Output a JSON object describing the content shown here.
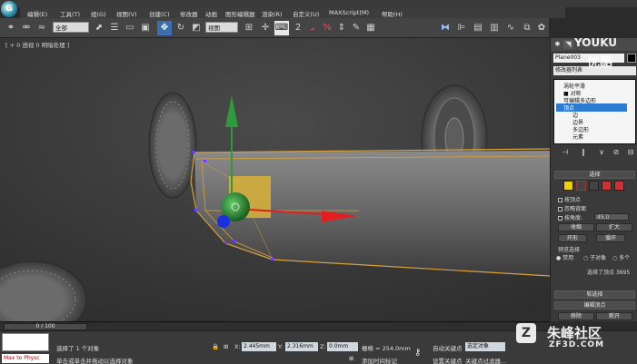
{
  "menu": [
    "编辑(E)",
    "工具(T)",
    "组(G)",
    "视图(V)",
    "创建(C)",
    "修改器",
    "动画",
    "图形编辑器",
    "渲染(R)",
    "自定义(U)",
    "MAXScript(M)",
    "帮助(H)"
  ],
  "toolbar": {
    "selection_set": "全部",
    "view_dropdown": "视图"
  },
  "viewport": {
    "label": "[ + 0 透视 0 明暗处理 ]"
  },
  "panel": {
    "object_name": "Plane003",
    "modifier_list": "修改器列表",
    "stack": [
      "涡轮平滑",
      "■ 对称",
      "可编辑多边形",
      "顶点",
      "边",
      "边界",
      "多边形",
      "元素"
    ],
    "stack_selected_index": 3,
    "selection_rollout": "选择",
    "checks": [
      "按顶点",
      "忽略背面",
      "按角度:"
    ],
    "angle_value": "45.0",
    "shrink": "收缩",
    "grow": "扩大",
    "ring": "环形",
    "loop": "循环",
    "preview_label": "预览选择",
    "preview_options": [
      "禁用",
      "子对象",
      "多个"
    ],
    "selected_info": "选择了顶点 3695",
    "soft_selection": "软选择",
    "edit_vertices": "编辑顶点",
    "remove": "移除",
    "break": "断开"
  },
  "timeline": {
    "position": "0 / 100"
  },
  "status": {
    "maxscript": "Max to Physc",
    "selection": "选择了 1 个对象",
    "hint": "单击或单击并拖动以选择对象",
    "x_label": "X:",
    "x": "2.445mm",
    "y_label": "Y:",
    "y": "2.316mm",
    "z_label": "Z:",
    "z": "0.0mm",
    "grid": "栅格 = 254.0mm",
    "add_tag": "添加时间标记",
    "auto_key": "自动关键点",
    "selected_set": "选定对象",
    "set_key": "设置关键点",
    "key_filters": "关键点过滤器..."
  },
  "watermarks": {
    "youku": "YOUKU",
    "youku_cn": "优酷",
    "site": "朱峰社区",
    "site_url": "ZF3D.COM"
  },
  "colors": {
    "selection_orange": "#d9a23a",
    "gizmo_green": "#2e9a3a",
    "gizmo_red": "#e02020",
    "gizmo_blue": "#1a2fe0",
    "panel_blue": "#2b7bd1"
  }
}
